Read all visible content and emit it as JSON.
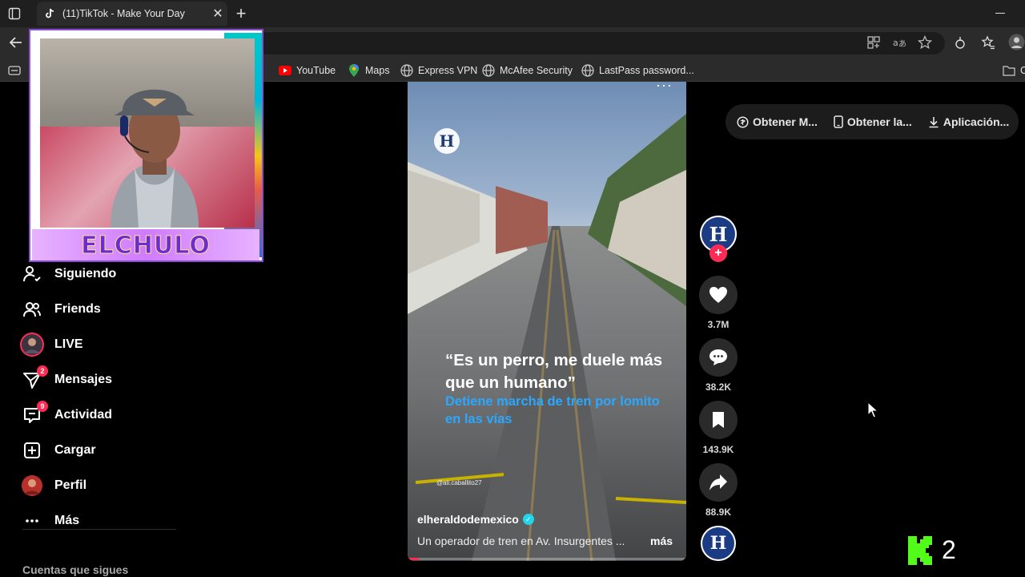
{
  "browser": {
    "tab_title": "(11)TikTok - Make Your Day",
    "bookmarks": [
      {
        "label": "YouTube",
        "icon": "youtube-icon"
      },
      {
        "label": "Maps",
        "icon": "maps-pin-icon"
      },
      {
        "label": "Express VPN",
        "icon": "globe-icon"
      },
      {
        "label": "McAfee Security",
        "icon": "globe-icon"
      },
      {
        "label": "LastPass password...",
        "icon": "globe-icon"
      }
    ],
    "bookmarks_overflow": "C"
  },
  "webcam": {
    "banner_text": "ELCHULO"
  },
  "sidebar": {
    "items": [
      {
        "label": "Siguiendo",
        "icon": "following-icon"
      },
      {
        "label": "Friends",
        "icon": "friends-icon"
      },
      {
        "label": "LIVE",
        "icon": "live-avatar"
      },
      {
        "label": "Mensajes",
        "icon": "messages-icon",
        "badge": "2"
      },
      {
        "label": "Actividad",
        "icon": "activity-icon",
        "badge": "9"
      },
      {
        "label": "Cargar",
        "icon": "upload-icon"
      },
      {
        "label": "Perfil",
        "icon": "profile-avatar"
      },
      {
        "label": "Más",
        "icon": "more-icon"
      }
    ],
    "following_title": "Cuentas que sigues"
  },
  "video": {
    "quote": "“Es un perro, me duele más que un humano”",
    "subquote": "Detiene marcha de tren por lomito en las vías",
    "watermark": "@ali.caballito27",
    "author": "elheraldodemexico",
    "description": "Un operador de tren en Av. Insurgentes ...",
    "more_label": "más",
    "progress": 0.04,
    "logo_letter": "H"
  },
  "actions": {
    "likes": "3.7M",
    "comments": "38.2K",
    "saves": "143.9K",
    "shares": "88.9K",
    "avatar_letter": "H"
  },
  "promo": {
    "items": [
      "Obtener M...",
      "Obtener la...",
      "Aplicación..."
    ]
  },
  "kick": {
    "count": "2"
  },
  "colors": {
    "accent": "#fe2c55",
    "verified": "#20d5ec",
    "subquote": "#2aa8ff",
    "kick_green": "#53fc18"
  }
}
